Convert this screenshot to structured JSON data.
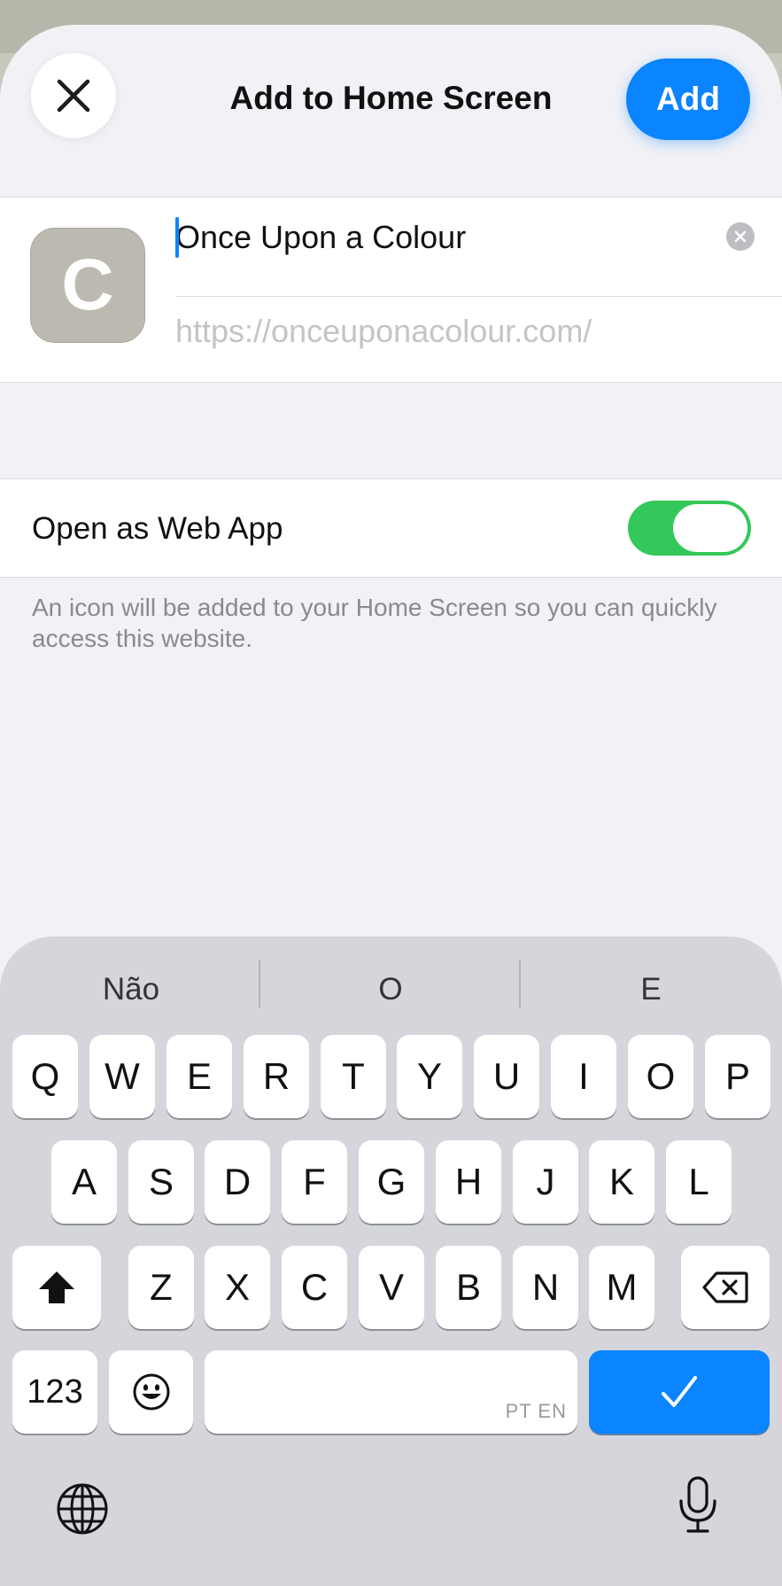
{
  "sheet": {
    "title": "Add to Home Screen",
    "close_icon": "close-icon",
    "add_label": "Add"
  },
  "bookmark": {
    "icon_letter": "C",
    "icon_color": "#bcb9b0",
    "name_value": "Once Upon a Colour",
    "url": "https://onceuponacolour.com/"
  },
  "web_app": {
    "label": "Open as Web App",
    "enabled": true,
    "toggle_color": "#34c759"
  },
  "footnote": "An icon will be added to your Home Screen so you can quickly access this website.",
  "keyboard": {
    "suggestions": [
      "Não",
      "O",
      "E"
    ],
    "row1": [
      "Q",
      "W",
      "E",
      "R",
      "T",
      "Y",
      "U",
      "I",
      "O",
      "P"
    ],
    "row2": [
      "A",
      "S",
      "D",
      "F",
      "G",
      "H",
      "J",
      "K",
      "L"
    ],
    "row3": [
      "Z",
      "X",
      "C",
      "V",
      "B",
      "N",
      "M"
    ],
    "numbers_label": "123",
    "space_lang": "PT EN",
    "accent_color": "#0a84ff"
  }
}
